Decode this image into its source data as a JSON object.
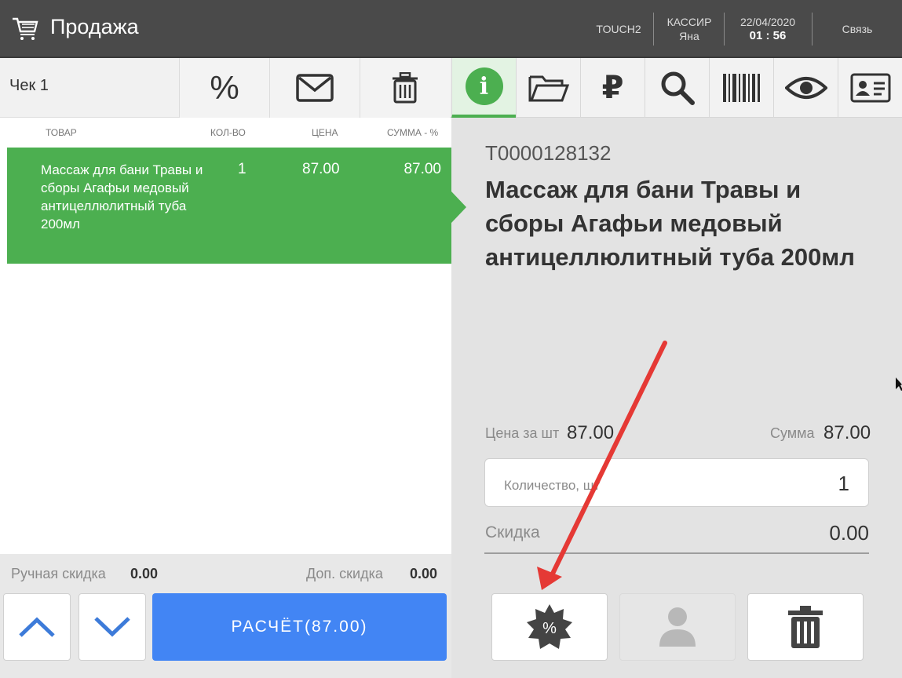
{
  "header": {
    "title": "Продажа",
    "terminal": "TOUCH2",
    "cashier_label": "КАССИР",
    "cashier_name": "Яна",
    "date": "22/04/2020",
    "time": "01 : 56",
    "link": "Связь"
  },
  "check": {
    "label": "Чек 1",
    "columns": [
      "ТОВАР",
      "КОЛ-ВО",
      "ЦЕНА",
      "СУММА - %"
    ],
    "items": [
      {
        "name": "Массаж для бани Травы и сборы Агафьи медовый антицеллюлитный туба 200мл",
        "qty": "1",
        "price": "87.00",
        "sum": "87.00",
        "selected": true
      }
    ],
    "manual_discount_label": "Ручная скидка",
    "manual_discount_value": "0.00",
    "extra_discount_label": "Доп. скидка",
    "extra_discount_value": "0.00",
    "pay_button": "РАСЧЁТ(87.00)"
  },
  "toolbar_left": [
    "percent-icon",
    "mail-icon",
    "trash-icon"
  ],
  "toolbar_right": [
    "info-icon",
    "folder-icon",
    "ruble-icon",
    "search-icon",
    "barcode-icon",
    "eye-icon",
    "id-card-icon"
  ],
  "toolbar_glyphs": {
    "percent": "%",
    "info": "i",
    "ruble": "₽"
  },
  "product": {
    "code": "T0000128132",
    "name": "Массаж для бани Травы и сборы Агафьи медовый антицеллюлитный туба 200мл",
    "price_label": "Цена за шт",
    "price_value": "87.00",
    "sum_label": "Сумма",
    "sum_value": "87.00",
    "qty_placeholder": "Количество, шт",
    "qty_value": "1",
    "discount_label": "Скидка",
    "discount_value": "0.00",
    "discount_button_glyph": "%"
  },
  "colors": {
    "header": "#4a4a4a",
    "accent_green": "#4caf50",
    "pay_blue": "#4285f4",
    "arrow_red": "#e53935"
  }
}
